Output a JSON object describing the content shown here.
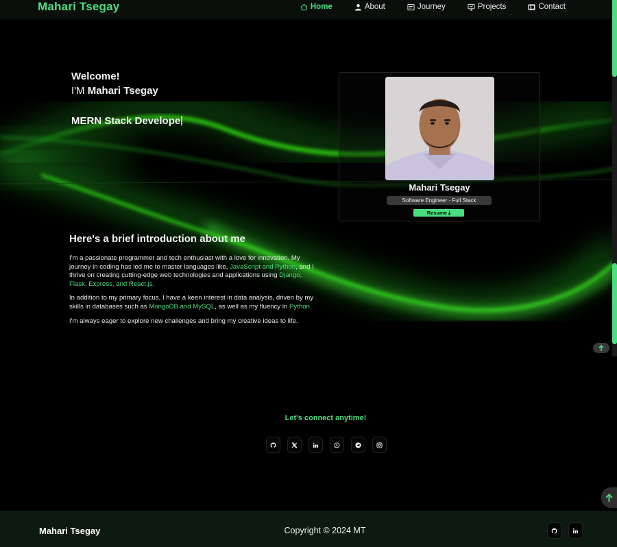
{
  "nav": {
    "brand": "Mahari Tsegay",
    "links": [
      {
        "label": "Home",
        "icon": "home-icon",
        "active": true
      },
      {
        "label": "About",
        "icon": "user-icon"
      },
      {
        "label": "Journey",
        "icon": "journey-icon"
      },
      {
        "label": "Projects",
        "icon": "projects-icon"
      },
      {
        "label": "Contact",
        "icon": "id-card-icon"
      }
    ]
  },
  "hero": {
    "welcome": "Welcome!",
    "im_prefix": "I'M ",
    "name": "Mahari Tsegay",
    "role_typed": "MERN Stack Develope"
  },
  "profile_card": {
    "name": "Mahari Tsegay",
    "title": "Software Engineer - Full Stack",
    "resume_label": "Resume"
  },
  "intro": {
    "heading": "Here's a brief introduction about me",
    "p1_a": "I'm a passionate programmer and tech enthusiast with a love for innovation. My journey in coding has led me to master languages like, ",
    "p1_hl1": "JavaScript and Python",
    "p1_b": ", and I thrive on creating cutting-edge web technologies and applications using ",
    "p1_hl2": "Django, Flask, Express, and React.js.",
    "p2_a": "In addition to my primary focus, I have a keen interest in data analysis, driven by my skills in databases such as ",
    "p2_hl1": "MongoDB and MySQL",
    "p2_b": ", as well as my fluency in ",
    "p2_hl2": "Python.",
    "p3": "I'm always eager to explore new challenges and bring my creative ideas to life."
  },
  "connect": {
    "title": "Let's connect anytime!",
    "socials": [
      "github-icon",
      "x-icon",
      "linkedin-icon",
      "whatsapp-icon",
      "telegram-icon",
      "instagram-icon"
    ]
  },
  "footer": {
    "brand": "Mahari Tsegay",
    "copyright": "Copyright © 2024 MT",
    "socials": [
      "github-icon",
      "linkedin-icon"
    ]
  },
  "colors": {
    "accent": "#4ade80",
    "background": "#000000",
    "footer_bg": "#0d1a12"
  }
}
